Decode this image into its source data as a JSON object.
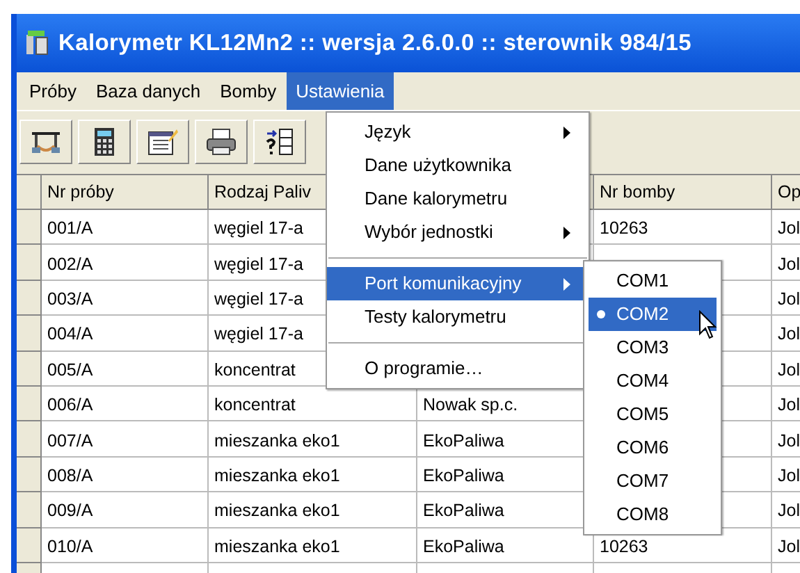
{
  "window": {
    "title": "Kalorymetr KL12Mn2 :: wersja 2.6.0.0 :: sterownik 984/15"
  },
  "menu_bar": [
    {
      "label": "Próby",
      "selected": false
    },
    {
      "label": "Baza danych",
      "selected": false
    },
    {
      "label": "Bomby",
      "selected": false
    },
    {
      "label": "Ustawienia",
      "selected": true
    }
  ],
  "table": {
    "columns": [
      {
        "label": "Nr próby"
      },
      {
        "label": "Rodzaj Paliv"
      },
      {},
      {
        "label": "Nr bomby"
      },
      {
        "label": "Op"
      }
    ],
    "rows": [
      {
        "nr_proby": "001/A",
        "rodzaj_paliwa": "węgiel 17-a",
        "nr_bomby": "10263",
        "op": "Jol"
      },
      {
        "nr_proby": "002/A",
        "rodzaj_paliwa": "węgiel 17-a",
        "op": "Jol"
      },
      {
        "nr_proby": "003/A",
        "rodzaj_paliwa": "węgiel 17-a",
        "op": "Jol"
      },
      {
        "nr_proby": "004/A",
        "rodzaj_paliwa": "węgiel 17-a",
        "op": "Jol"
      },
      {
        "nr_proby": "005/A",
        "rodzaj_paliwa": "koncentrat",
        "op": "Jol"
      },
      {
        "nr_proby": "006/A",
        "rodzaj_paliwa": "koncentrat",
        "column_3": "Nowak sp.c.",
        "op": "Jol"
      },
      {
        "nr_proby": "007/A",
        "rodzaj_paliwa": "mieszanka eko1",
        "column_3": "EkoPaliwa",
        "op": "Jol"
      },
      {
        "nr_proby": "008/A",
        "rodzaj_paliwa": "mieszanka eko1",
        "column_3": "EkoPaliwa",
        "op": "Jol"
      },
      {
        "nr_proby": "009/A",
        "rodzaj_paliwa": "mieszanka eko1",
        "column_3": "EkoPaliwa",
        "op": "Jol"
      },
      {
        "nr_proby": "010/A",
        "rodzaj_paliwa": "mieszanka eko1",
        "column_3": "EkoPaliwa",
        "nr_bomby": "10263",
        "op": "Jol"
      }
    ]
  },
  "settings_menu": [
    {
      "kind": "item",
      "label": "Język",
      "has_submenu": true,
      "selected": false
    },
    {
      "kind": "item",
      "label": "Dane użytkownika",
      "has_submenu": false,
      "selected": false
    },
    {
      "kind": "item",
      "label": "Dane kalorymetru",
      "has_submenu": false,
      "selected": false
    },
    {
      "kind": "item",
      "label": "Wybór jednostki",
      "has_submenu": true,
      "selected": false
    },
    {
      "kind": "separator"
    },
    {
      "kind": "item",
      "label": "Port komunikacyjny",
      "has_submenu": true,
      "selected": true
    },
    {
      "kind": "item",
      "label": "Testy kalorymetru",
      "has_submenu": false,
      "selected": false
    },
    {
      "kind": "separator"
    },
    {
      "kind": "item",
      "label": "O programie…",
      "has_submenu": false,
      "selected": false
    }
  ],
  "port_submenu": [
    {
      "label": "COM1",
      "checked": false,
      "selected": false
    },
    {
      "label": "COM2",
      "checked": true,
      "selected": true
    },
    {
      "label": "COM3",
      "checked": false,
      "selected": false
    },
    {
      "label": "COM4",
      "checked": false,
      "selected": false
    },
    {
      "label": "COM5",
      "checked": false,
      "selected": false
    },
    {
      "label": "COM6",
      "checked": false,
      "selected": false
    },
    {
      "label": "COM7",
      "checked": false,
      "selected": false
    },
    {
      "label": "COM8",
      "checked": false,
      "selected": false
    }
  ]
}
